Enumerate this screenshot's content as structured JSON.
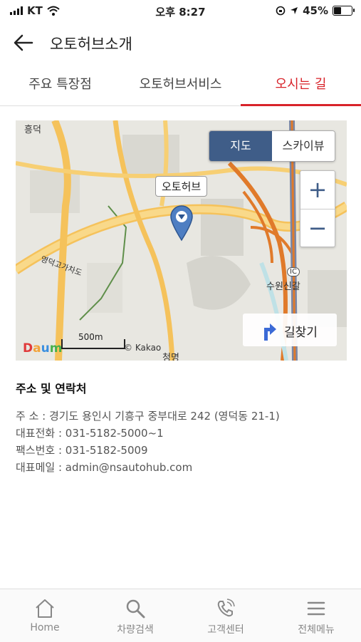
{
  "status_bar": {
    "carrier": "KT",
    "time": "오후 8:27",
    "battery": "45%",
    "battery_level": 0.45
  },
  "header": {
    "title": "오토허브소개",
    "back_icon": "arrow-left-icon"
  },
  "tabs": [
    {
      "label": "주요 특장점",
      "active": false
    },
    {
      "label": "오토허브서비스",
      "active": false
    },
    {
      "label": "오시는 길",
      "active": true
    }
  ],
  "map": {
    "type_buttons": [
      {
        "label": "지도",
        "active": true
      },
      {
        "label": "스카이뷰",
        "active": false
      }
    ],
    "zoom_in": "+",
    "zoom_out": "−",
    "poi_label": "오토허브",
    "route_button": "길찾기",
    "place_labels": {
      "heungdeok": "흥덕",
      "road": "영덕고가차도",
      "suwon_ic": "수원신갈",
      "ic": "IC",
      "cheongmyeong": "청명"
    },
    "scale_label": "500m",
    "logo": "Daum",
    "credit": "© Kakao",
    "accent_color": "#3f5d88"
  },
  "info": {
    "heading": "주소 및 연락처",
    "rows": [
      "주       소 : 경기도 용인시 기흥구 중부대로 242 (영덕동 21-1)",
      "대표전화 : 031-5182-5000~1",
      "팩스번호 : 031-5182-5009",
      "대표메일 : admin@nsautohub.com"
    ]
  },
  "bottom_nav": [
    {
      "label": "Home",
      "icon": "home-icon"
    },
    {
      "label": "차량검색",
      "icon": "search-icon"
    },
    {
      "label": "고객센터",
      "icon": "phone-icon"
    },
    {
      "label": "전체메뉴",
      "icon": "menu-icon"
    }
  ],
  "colors": {
    "accent_red": "#d8232a",
    "map_blue": "#3f5d88"
  }
}
